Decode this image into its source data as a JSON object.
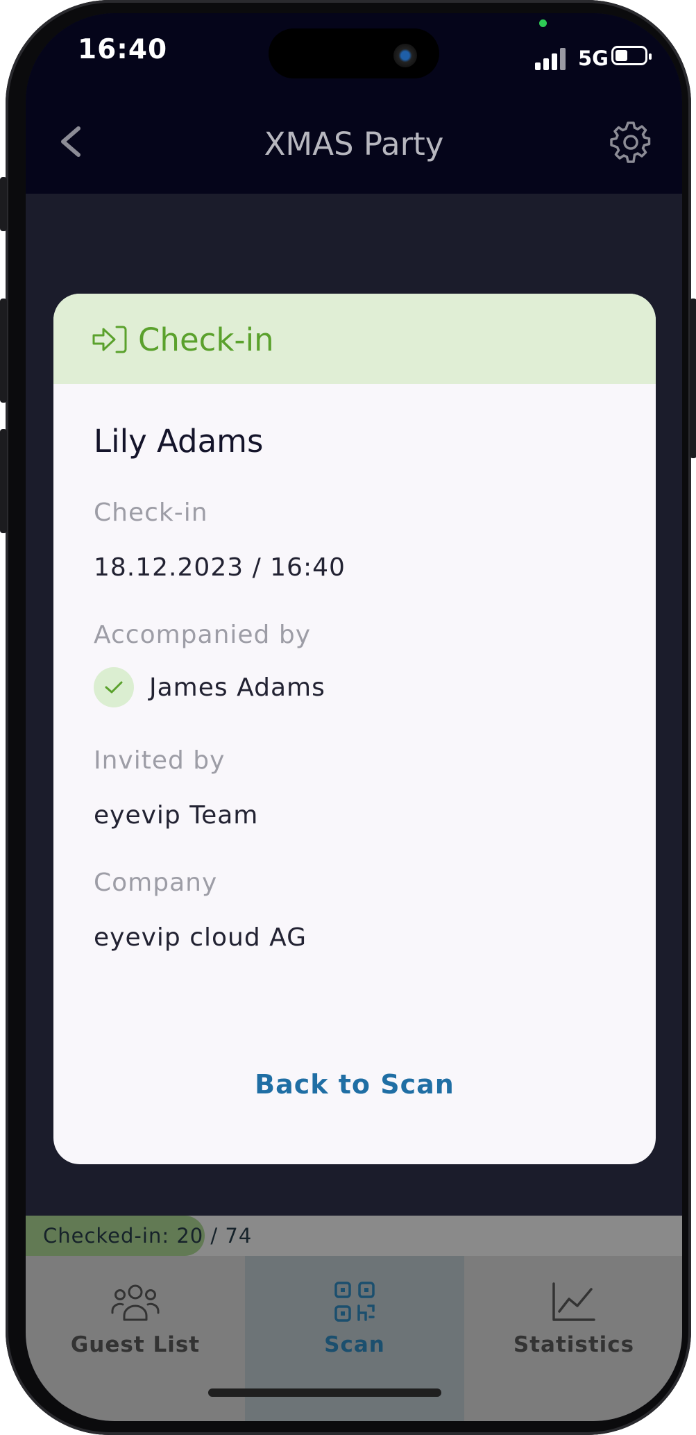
{
  "status_bar": {
    "time": "16:40",
    "network": "5G"
  },
  "header": {
    "title": "XMAS Party",
    "back_icon": "chevron-left-icon",
    "settings_icon": "gear-icon"
  },
  "card": {
    "header_title": "Check-in",
    "header_color": "#5aa12c",
    "guest_name": "Lily Adams",
    "fields": {
      "checkin_label": "Check-in",
      "checkin_value": "18.12.2023 / 16:40",
      "accompanied_label": "Accompanied by",
      "accompanied_value": "James Adams",
      "invited_label": "Invited by",
      "invited_value": "eyevip Team",
      "company_label": "Company",
      "company_value": "eyevip cloud AG"
    },
    "back_button": "Back to Scan",
    "back_button_color": "#1f6ea4"
  },
  "counter": {
    "text": "Checked-in: 20 / 74",
    "checked_in": 20,
    "total": 74
  },
  "tabs": [
    {
      "label": "Guest List",
      "icon": "people-icon",
      "active": false
    },
    {
      "label": "Scan",
      "icon": "qr-code-icon",
      "active": true
    },
    {
      "label": "Statistics",
      "icon": "chart-line-icon",
      "active": false
    }
  ]
}
